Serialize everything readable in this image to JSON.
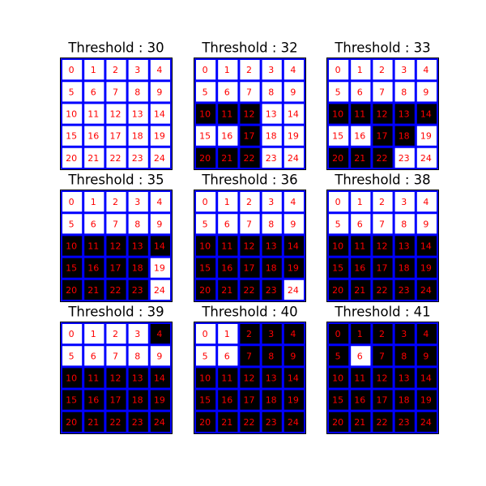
{
  "colors": {
    "on": "#ffffff",
    "off": "#000000",
    "grid": "#0000ff",
    "label": "#ff0000",
    "frame": "#000000"
  },
  "chart_data": [
    {
      "type": "heatmap",
      "title": "Threshold : 30",
      "rows": 5,
      "cols": 5,
      "labels": [
        0,
        1,
        2,
        3,
        4,
        5,
        6,
        7,
        8,
        9,
        10,
        11,
        12,
        13,
        14,
        15,
        16,
        17,
        18,
        19,
        20,
        21,
        22,
        23,
        24
      ],
      "values": [
        [
          1,
          1,
          1,
          1,
          1
        ],
        [
          1,
          1,
          1,
          1,
          1
        ],
        [
          1,
          1,
          1,
          1,
          1
        ],
        [
          1,
          1,
          1,
          1,
          1
        ],
        [
          1,
          1,
          1,
          1,
          1
        ]
      ]
    },
    {
      "type": "heatmap",
      "title": "Threshold : 32",
      "rows": 5,
      "cols": 5,
      "labels": [
        0,
        1,
        2,
        3,
        4,
        5,
        6,
        7,
        8,
        9,
        10,
        11,
        12,
        13,
        14,
        15,
        16,
        17,
        18,
        19,
        20,
        21,
        22,
        23,
        24
      ],
      "values": [
        [
          1,
          1,
          1,
          1,
          1
        ],
        [
          1,
          1,
          1,
          1,
          1
        ],
        [
          0,
          0,
          0,
          1,
          1
        ],
        [
          1,
          1,
          0,
          1,
          1
        ],
        [
          0,
          0,
          0,
          1,
          1
        ]
      ]
    },
    {
      "type": "heatmap",
      "title": "Threshold : 33",
      "rows": 5,
      "cols": 5,
      "labels": [
        0,
        1,
        2,
        3,
        4,
        5,
        6,
        7,
        8,
        9,
        10,
        11,
        12,
        13,
        14,
        15,
        16,
        17,
        18,
        19,
        20,
        21,
        22,
        23,
        24
      ],
      "values": [
        [
          1,
          1,
          1,
          1,
          1
        ],
        [
          1,
          1,
          1,
          1,
          1
        ],
        [
          0,
          0,
          0,
          0,
          0
        ],
        [
          1,
          1,
          0,
          0,
          1
        ],
        [
          0,
          0,
          0,
          1,
          1
        ]
      ]
    },
    {
      "type": "heatmap",
      "title": "Threshold : 35",
      "rows": 5,
      "cols": 5,
      "labels": [
        0,
        1,
        2,
        3,
        4,
        5,
        6,
        7,
        8,
        9,
        10,
        11,
        12,
        13,
        14,
        15,
        16,
        17,
        18,
        19,
        20,
        21,
        22,
        23,
        24
      ],
      "values": [
        [
          1,
          1,
          1,
          1,
          1
        ],
        [
          1,
          1,
          1,
          1,
          1
        ],
        [
          0,
          0,
          0,
          0,
          0
        ],
        [
          0,
          0,
          0,
          0,
          1
        ],
        [
          0,
          0,
          0,
          0,
          1
        ]
      ]
    },
    {
      "type": "heatmap",
      "title": "Threshold : 36",
      "rows": 5,
      "cols": 5,
      "labels": [
        0,
        1,
        2,
        3,
        4,
        5,
        6,
        7,
        8,
        9,
        10,
        11,
        12,
        13,
        14,
        15,
        16,
        17,
        18,
        19,
        20,
        21,
        22,
        23,
        24
      ],
      "values": [
        [
          1,
          1,
          1,
          1,
          1
        ],
        [
          1,
          1,
          1,
          1,
          1
        ],
        [
          0,
          0,
          0,
          0,
          0
        ],
        [
          0,
          0,
          0,
          0,
          0
        ],
        [
          0,
          0,
          0,
          0,
          1
        ]
      ]
    },
    {
      "type": "heatmap",
      "title": "Threshold : 38",
      "rows": 5,
      "cols": 5,
      "labels": [
        0,
        1,
        2,
        3,
        4,
        5,
        6,
        7,
        8,
        9,
        10,
        11,
        12,
        13,
        14,
        15,
        16,
        17,
        18,
        19,
        20,
        21,
        22,
        23,
        24
      ],
      "values": [
        [
          1,
          1,
          1,
          1,
          1
        ],
        [
          1,
          1,
          1,
          1,
          1
        ],
        [
          0,
          0,
          0,
          0,
          0
        ],
        [
          0,
          0,
          0,
          0,
          0
        ],
        [
          0,
          0,
          0,
          0,
          0
        ]
      ]
    },
    {
      "type": "heatmap",
      "title": "Threshold : 39",
      "rows": 5,
      "cols": 5,
      "labels": [
        0,
        1,
        2,
        3,
        4,
        5,
        6,
        7,
        8,
        9,
        10,
        11,
        12,
        13,
        14,
        15,
        16,
        17,
        18,
        19,
        20,
        21,
        22,
        23,
        24
      ],
      "values": [
        [
          1,
          1,
          1,
          1,
          0
        ],
        [
          1,
          1,
          1,
          1,
          1
        ],
        [
          0,
          0,
          0,
          0,
          0
        ],
        [
          0,
          0,
          0,
          0,
          0
        ],
        [
          0,
          0,
          0,
          0,
          0
        ]
      ]
    },
    {
      "type": "heatmap",
      "title": "Threshold : 40",
      "rows": 5,
      "cols": 5,
      "labels": [
        0,
        1,
        2,
        3,
        4,
        5,
        6,
        7,
        8,
        9,
        10,
        11,
        12,
        13,
        14,
        15,
        16,
        17,
        18,
        19,
        20,
        21,
        22,
        23,
        24
      ],
      "values": [
        [
          1,
          1,
          0,
          0,
          0
        ],
        [
          1,
          1,
          0,
          0,
          0
        ],
        [
          0,
          0,
          0,
          0,
          0
        ],
        [
          0,
          0,
          0,
          0,
          0
        ],
        [
          0,
          0,
          0,
          0,
          0
        ]
      ]
    },
    {
      "type": "heatmap",
      "title": "Threshold : 41",
      "rows": 5,
      "cols": 5,
      "labels": [
        0,
        1,
        2,
        3,
        4,
        5,
        6,
        7,
        8,
        9,
        10,
        11,
        12,
        13,
        14,
        15,
        16,
        17,
        18,
        19,
        20,
        21,
        22,
        23,
        24
      ],
      "values": [
        [
          0,
          0,
          0,
          0,
          0
        ],
        [
          0,
          1,
          0,
          0,
          0
        ],
        [
          0,
          0,
          0,
          0,
          0
        ],
        [
          0,
          0,
          0,
          0,
          0
        ],
        [
          0,
          0,
          0,
          0,
          0
        ]
      ]
    }
  ]
}
